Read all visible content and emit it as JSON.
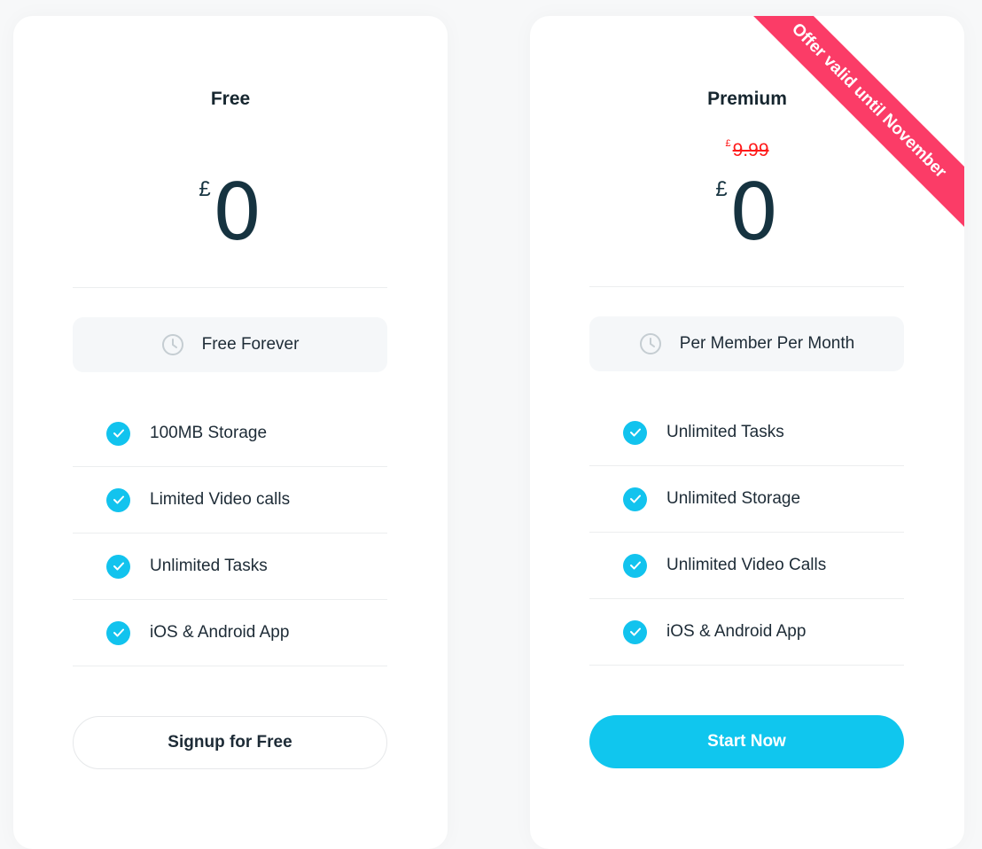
{
  "colors": {
    "accent": "#10c6ee",
    "ribbon": "#fb3c67",
    "strike_price": "#ff1a1a",
    "text": "#1d2b36"
  },
  "plans": [
    {
      "name": "Free",
      "currency": "£",
      "price": "0",
      "billing_icon": "clock-icon",
      "billing": "Free Forever",
      "features": [
        "100MB Storage",
        "Limited Video calls",
        "Unlimited Tasks",
        "iOS & Android App"
      ],
      "feature_icon": "check-circle-icon",
      "cta": "Signup for Free"
    },
    {
      "name": "Premium",
      "old_currency": "£",
      "old_price": "9.99",
      "currency": "£",
      "price": "0",
      "billing_icon": "clock-icon",
      "billing": "Per Member Per Month",
      "features": [
        "Unlimited Tasks",
        "Unlimited Storage",
        "Unlimited Video Calls",
        "iOS & Android App"
      ],
      "feature_icon": "check-circle-icon",
      "cta": "Start Now",
      "ribbon": "Offer valid until November"
    }
  ]
}
